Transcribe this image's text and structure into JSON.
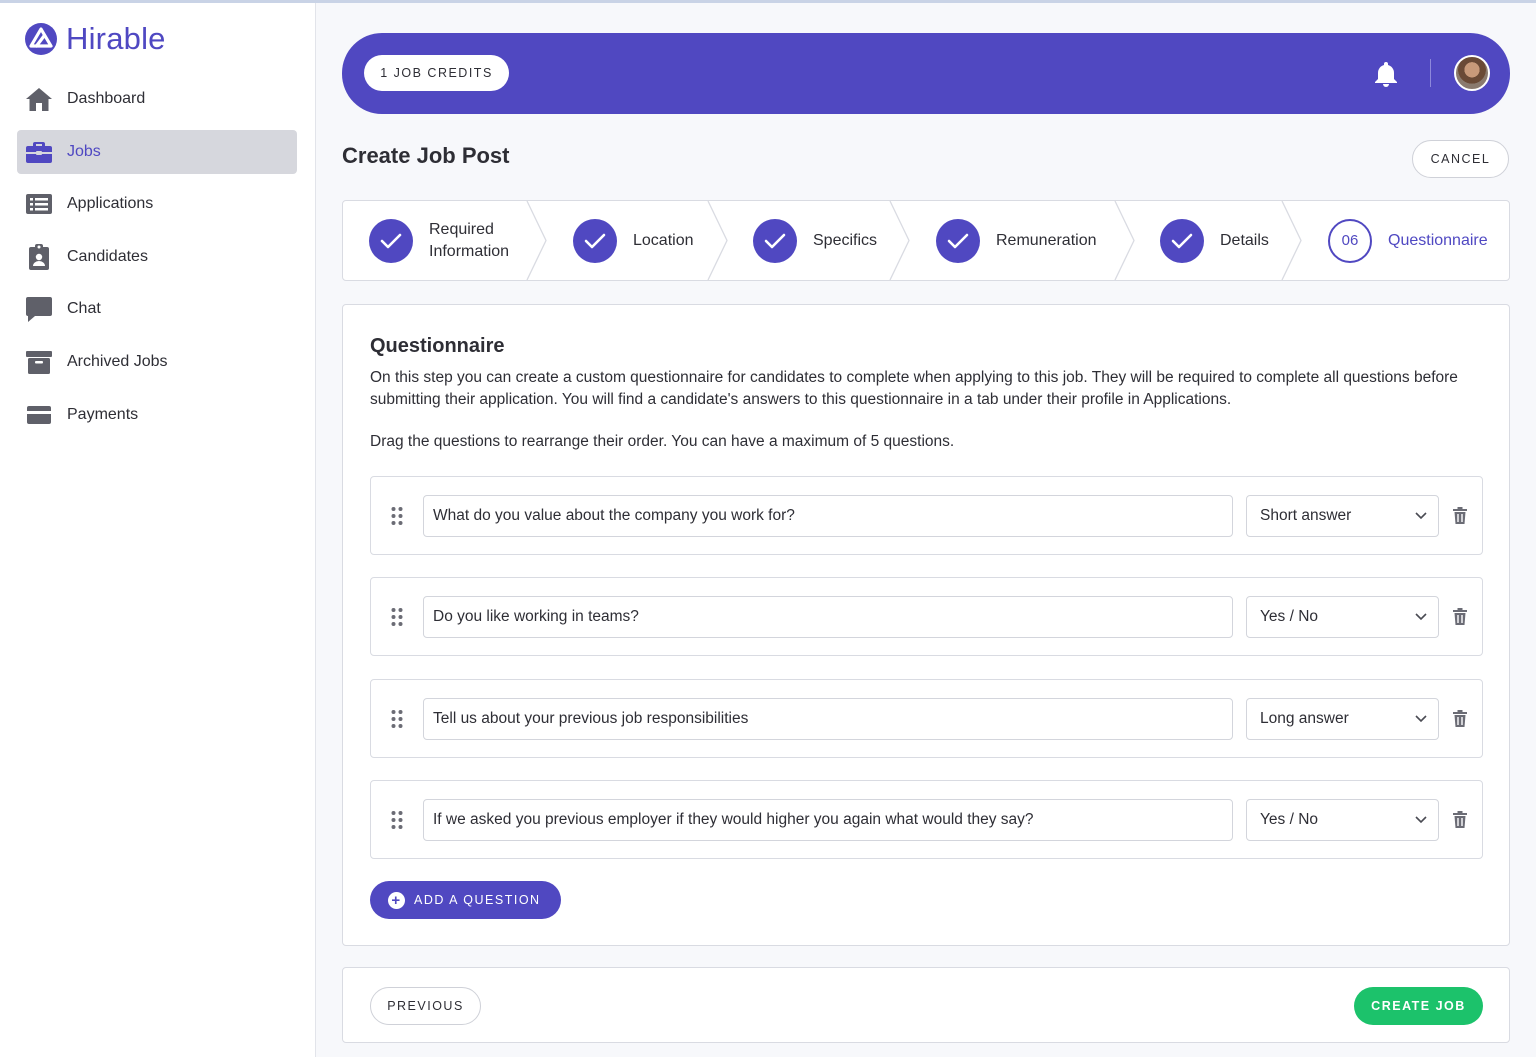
{
  "brand": {
    "name": "Hirable",
    "accent": "#5048c1"
  },
  "sidebar": {
    "items": [
      {
        "label": "Dashboard",
        "icon": "home-icon",
        "active": false
      },
      {
        "label": "Jobs",
        "icon": "briefcase-icon",
        "active": true
      },
      {
        "label": "Applications",
        "icon": "list-icon",
        "active": false
      },
      {
        "label": "Candidates",
        "icon": "clipboard-user-icon",
        "active": false
      },
      {
        "label": "Chat",
        "icon": "chat-bubble-icon",
        "active": false
      },
      {
        "label": "Archived Jobs",
        "icon": "archive-box-icon",
        "active": false
      },
      {
        "label": "Payments",
        "icon": "credit-card-icon",
        "active": false
      }
    ]
  },
  "header": {
    "credits_label": "1 JOB CREDITS"
  },
  "page": {
    "title": "Create Job Post",
    "cancel_label": "CANCEL"
  },
  "stepper": {
    "steps": [
      {
        "label_line1": "Required",
        "label_line2": "Information",
        "status": "done"
      },
      {
        "label": "Location",
        "status": "done"
      },
      {
        "label": "Specifics",
        "status": "done"
      },
      {
        "label": "Remuneration",
        "status": "done"
      },
      {
        "label": "Details",
        "status": "done"
      },
      {
        "number": "06",
        "label": "Questionnaire",
        "status": "current"
      }
    ]
  },
  "questionnaire": {
    "title": "Questionnaire",
    "description": "On this step you can create a custom questionnaire for candidates to complete when applying to this job. They will be required to complete all questions before submitting their application. You will find a candidate's answers to this questionnaire in a tab under their profile in Applications.",
    "instructions": "Drag the questions to rearrange their order. You can have a maximum of 5 questions.",
    "questions": [
      {
        "text": "What do you value about the company you work for?",
        "type": "Short answer"
      },
      {
        "text": "Do you like working in teams?",
        "type": "Yes / No"
      },
      {
        "text": "Tell us about your previous job responsibilities",
        "type": "Long answer"
      },
      {
        "text": "If we asked you previous employer if they would higher you again what would they say?",
        "type": "Yes / No"
      }
    ],
    "add_label": "ADD A QUESTION"
  },
  "footer": {
    "previous_label": "PREVIOUS",
    "create_label": "CREATE JOB",
    "create_color": "#1cc26b"
  }
}
